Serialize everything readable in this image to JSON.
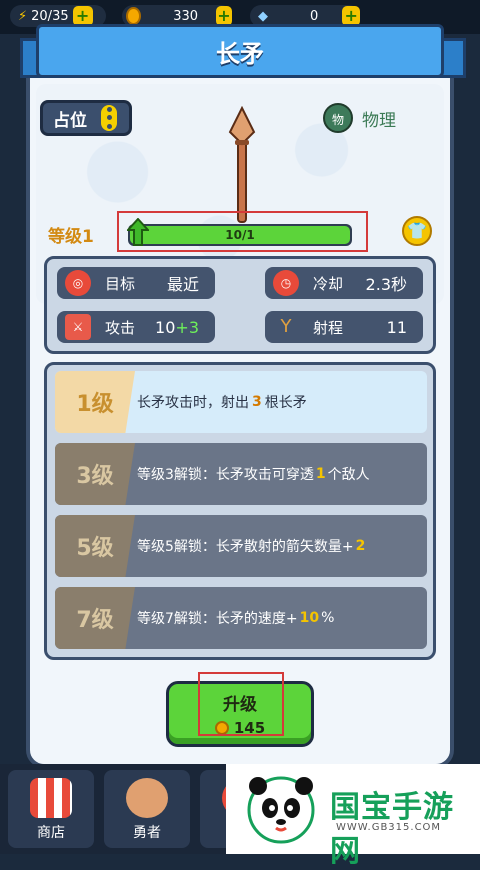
{
  "topbar": {
    "energy": "20/35",
    "gold": "330",
    "gems": "0"
  },
  "dialog": {
    "title": "长矛",
    "position_button": "占位",
    "damage_type_icon": "物",
    "damage_type": "物理",
    "level_label": "等级1",
    "xp_text": "10/1",
    "xp_fraction": 1.0
  },
  "stats": [
    {
      "label": "目标",
      "value": "最近",
      "icon": "target-icon"
    },
    {
      "label": "冷却",
      "value": "2.3秒",
      "icon": "clock-icon"
    },
    {
      "label": "攻击",
      "value": "10",
      "bonus": "+3",
      "icon": "attack-icon"
    },
    {
      "label": "射程",
      "value": "11",
      "icon": "slingshot-icon"
    }
  ],
  "skills": [
    {
      "level": "1级",
      "pre": "长矛攻击时，射出",
      "num": "3",
      "post": "根长矛",
      "unlocked": true
    },
    {
      "level": "3级",
      "pre": "等级3解锁：长矛攻击可穿透",
      "num": "1",
      "post": "个敌人",
      "unlocked": false
    },
    {
      "level": "5级",
      "pre": "等级5解锁：长矛散射的箭矢数量+",
      "num": "2",
      "post": "",
      "unlocked": false
    },
    {
      "level": "7级",
      "pre": "等级7解锁：长矛的速度+",
      "num": "10",
      "post": "%",
      "unlocked": false
    }
  ],
  "upgrade": {
    "label": "升级",
    "cost": "145"
  },
  "nav": {
    "shop": "商店",
    "hero": "勇者"
  },
  "watermark": {
    "title": "国宝手游网",
    "url": "WWW.GB315.COM"
  },
  "colors": {
    "accent_blue": "#4aa6ee",
    "green": "#5cd43a",
    "panel": "#44546e",
    "highlight": "#f5c400"
  }
}
